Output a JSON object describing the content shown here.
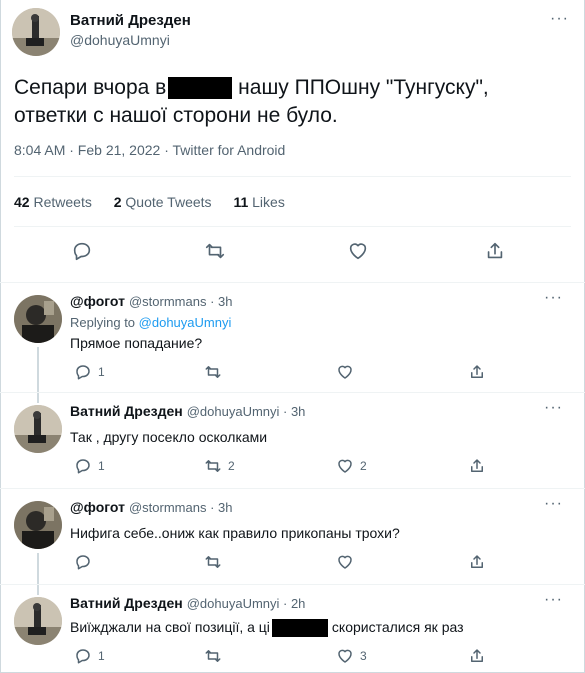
{
  "main": {
    "author_name": "Ватний Дрезден",
    "author_handle": "@dohuyaUmnyi",
    "text_part1": "Сепари вчора в",
    "text_part2": " нашу ППОшну \"Тунгуску\",",
    "text_line2": "ответки с нашої сторони не було.",
    "timestamp": "8:04 AM · Feb 21, 2022 · Twitter for Android",
    "retweets_count": "42",
    "retweets_label": "Retweets",
    "quotes_count": "2",
    "quotes_label": "Quote Tweets",
    "likes_count": "11",
    "likes_label": "Likes",
    "more": "···"
  },
  "replies": [
    {
      "name": "@фогот",
      "handle": "@stormmans · 3h",
      "replying_prefix": "Replying to ",
      "replying_to": "@dohuyaUmnyi",
      "text": "Прямое попадание?",
      "reply_count": "1",
      "retweet_count": "",
      "like_count": "",
      "more": "···"
    },
    {
      "name": "Ватний Дрезден",
      "handle": "@dohuyaUmnyi · 3h",
      "text": "Так , другу посекло осколками",
      "reply_count": "1",
      "retweet_count": "2",
      "like_count": "2",
      "more": "···"
    },
    {
      "name": "@фогот",
      "handle": "@stormmans · 3h",
      "text": "Нифига себе..ониж как правило прикопаны трохи?",
      "reply_count": "",
      "retweet_count": "",
      "like_count": "",
      "more": "···"
    },
    {
      "name": "Ватний Дрезден",
      "handle": "@dohuyaUmnyi · 2h",
      "text_part1": "Виїжджали на свої позиції, а ці",
      "text_part2": "скористалися як раз",
      "reply_count": "1",
      "retweet_count": "",
      "like_count": "3",
      "more": "···"
    }
  ],
  "icons": {
    "reply": "reply-icon",
    "retweet": "retweet-icon",
    "like": "heart-icon",
    "share": "share-icon"
  },
  "colors": {
    "link": "#1d9bf0",
    "secondary_text": "#536471",
    "primary_text": "#0f1419"
  }
}
